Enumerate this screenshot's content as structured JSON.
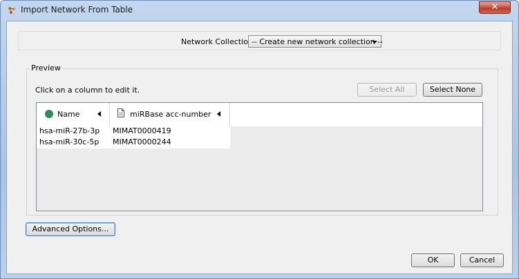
{
  "window": {
    "title": "Import Network From Table",
    "icon": "cytoscape-icon",
    "close_label": "✕"
  },
  "collection": {
    "label": "Network Collection:",
    "selected": "-- Create new network collection --"
  },
  "preview": {
    "legend": "Preview",
    "hint": "Click on a column to edit it.",
    "select_all_label": "Select All",
    "select_none_label": "Select None",
    "columns": [
      {
        "label": "Name",
        "icon": "green-dot-icon"
      },
      {
        "label": "miRBase acc-number",
        "icon": "document-icon"
      }
    ],
    "rows": [
      [
        "hsa-miR-27b-3p",
        "MIMAT0000419"
      ],
      [
        "hsa-miR-30c-5p",
        "MIMAT0000244"
      ]
    ]
  },
  "advanced_options_label": "Advanced Options...",
  "ok_label": "OK",
  "cancel_label": "Cancel",
  "colors": {
    "title_bar": "#b9d0ea",
    "close_button": "#c9503d",
    "source_column_dot": "#2e8b57"
  }
}
